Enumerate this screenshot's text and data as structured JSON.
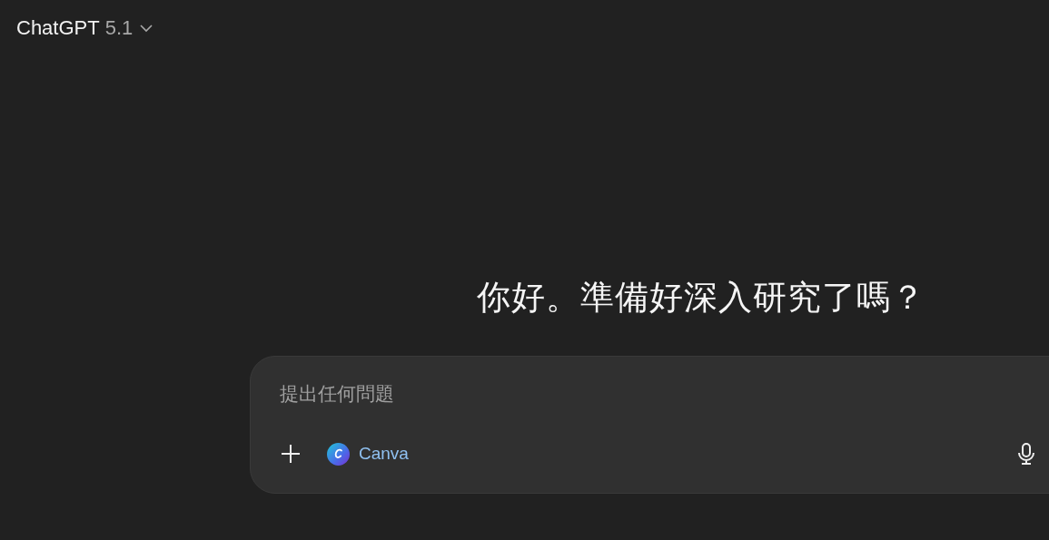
{
  "header": {
    "title": "ChatGPT",
    "version": "5.1"
  },
  "greeting": "你好。準備好深入研究了嗎？",
  "composer": {
    "placeholder": "提出任何問題",
    "tool": "Canva"
  }
}
